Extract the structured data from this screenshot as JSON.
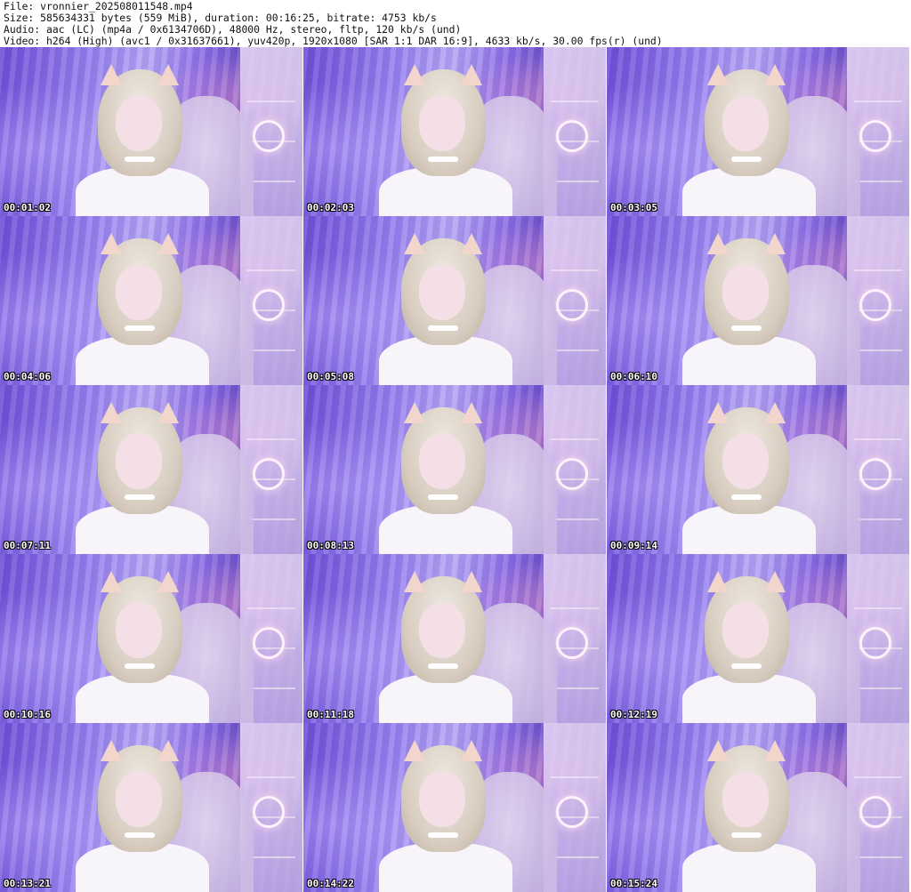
{
  "header": {
    "file_line": "File: vronnier_202508011548.mp4",
    "size_line": "Size: 585634331 bytes (559 MiB), duration: 00:16:25, bitrate: 4753 kb/s",
    "audio_line": "Audio: aac (LC) (mp4a / 0x6134706D), 48000 Hz, stereo, fltp, 120 kb/s (und)",
    "video_line": "Video: h264 (High) (avc1 / 0x31637661), yuv420p, 1920x1080 [SAR 1:1 DAR 16:9], 4633 kb/s, 30.00 fps(r) (und)"
  },
  "thumbnails": [
    {
      "timestamp": "00:01:02"
    },
    {
      "timestamp": "00:02:03"
    },
    {
      "timestamp": "00:03:05"
    },
    {
      "timestamp": "00:04:06"
    },
    {
      "timestamp": "00:05:08"
    },
    {
      "timestamp": "00:06:10"
    },
    {
      "timestamp": "00:07:11"
    },
    {
      "timestamp": "00:08:13"
    },
    {
      "timestamp": "00:09:14"
    },
    {
      "timestamp": "00:10:16"
    },
    {
      "timestamp": "00:11:18"
    },
    {
      "timestamp": "00:12:19"
    },
    {
      "timestamp": "00:13:21"
    },
    {
      "timestamp": "00:14:22"
    },
    {
      "timestamp": "00:15:24"
    }
  ]
}
